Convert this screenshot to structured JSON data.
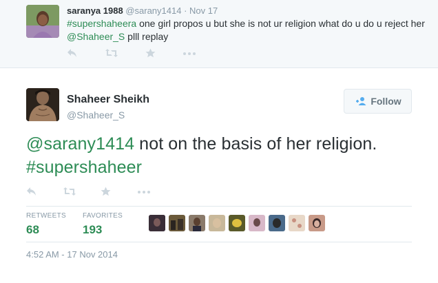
{
  "parent_tweet": {
    "name": "saranya 1988",
    "handle": "@sarany1414",
    "separator": "·",
    "time": "Nov 17",
    "text": {
      "hashtag": "#supershaheera",
      "part1": " one girl propos u but she is not ur religion what do u do u reject her ",
      "mention": "@Shaheer_S",
      "part2": " plll replay"
    },
    "actions": [
      "reply-icon",
      "retweet-icon",
      "favorite-icon",
      "more-icon"
    ]
  },
  "main_tweet": {
    "name": "Shaheer Sheikh",
    "handle": "@Shaheer_S",
    "follow_label": "Follow",
    "text": {
      "mention": "@sarany1414",
      "part1": " not on the basis of her religion. ",
      "hashtag": "#supershaheer"
    },
    "actions": [
      "reply-icon",
      "retweet-icon",
      "favorite-icon",
      "more-icon"
    ],
    "stats": {
      "retweets_label": "RETWEETS",
      "retweets_value": "68",
      "favorites_label": "FAVORITES",
      "favorites_value": "193"
    },
    "favoriter_avatars": 9,
    "timestamp": "4:52 AM - 17 Nov 2014"
  },
  "colors": {
    "accent": "#2d8c55",
    "muted": "#8899a6",
    "text": "#292f33",
    "icon": "#ccd6dd"
  }
}
